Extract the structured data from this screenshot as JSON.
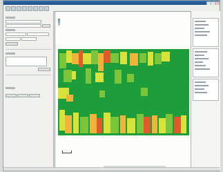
{
  "window": {
    "title": ""
  },
  "toolbar": {
    "icons": [
      "open-icon",
      "save-icon",
      "print-icon",
      "zoom-in-icon",
      "zoom-out-icon",
      "pan-icon",
      "select-icon",
      "measure-icon"
    ]
  },
  "left_panel": {
    "title": "",
    "fields": 6,
    "buttons": 4
  },
  "map": {
    "title": "",
    "legend_colors": [
      "#1e9e3a",
      "#7cc43a",
      "#d7e23a",
      "#f0b43a",
      "#e05a2a"
    ]
  },
  "right_panel": {
    "sections": 3
  },
  "statusbar": {
    "items": [
      "",
      "",
      "",
      ""
    ]
  }
}
